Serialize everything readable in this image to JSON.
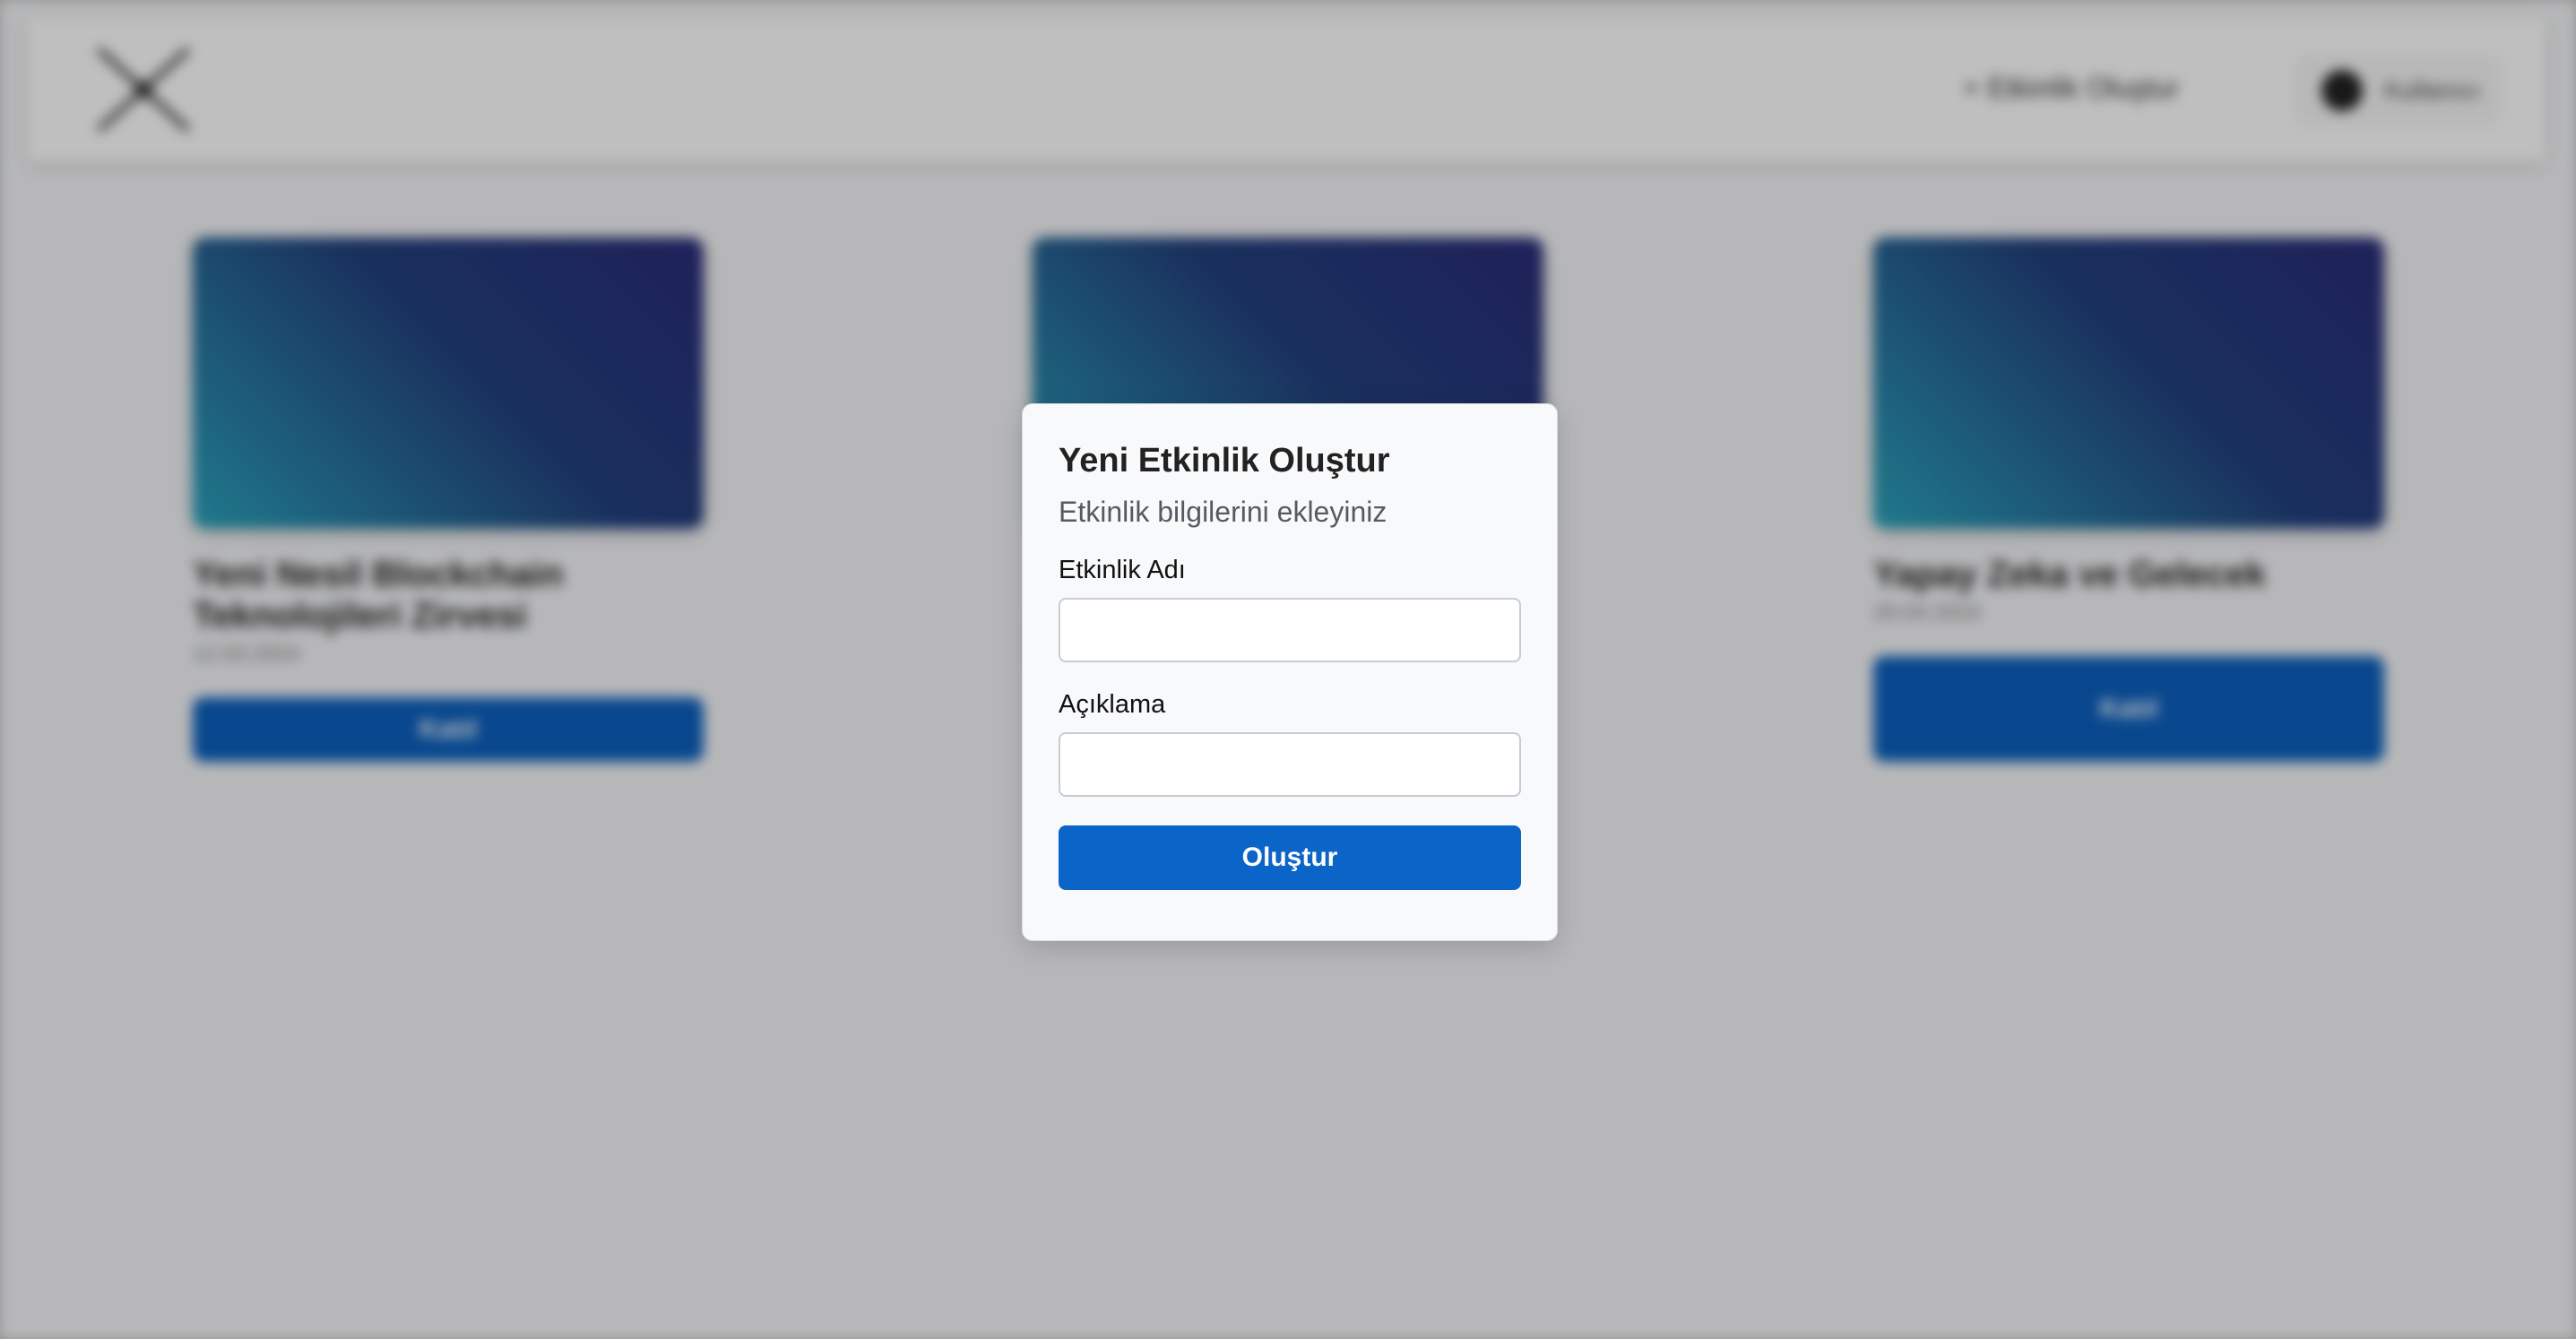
{
  "background": {
    "nav_link": "+ Etkinlik Oluştur",
    "user_name": "Kullanıcı",
    "cards": [
      {
        "title": "Yeni Nesil Blockchain Teknolojileri Zirvesi",
        "meta": "12.03.2024",
        "button": "Katıl"
      },
      {
        "title": "",
        "meta": "",
        "button": ""
      },
      {
        "title": "Yapay Zeka ve Gelecek",
        "meta": "20.04.2024",
        "button": "Katıl"
      }
    ]
  },
  "modal": {
    "title": "Yeni Etkinlik Oluştur",
    "subtitle": "Etkinlik bilgilerini ekleyiniz",
    "name_label": "Etkinlik Adı",
    "name_value": "",
    "description_label": "Açıklama",
    "description_value": "",
    "submit_label": "Oluştur"
  },
  "colors": {
    "primary_button": "#0b65c8",
    "card_gradient_start": "#2aa3bb",
    "card_gradient_end": "#2a2c78"
  },
  "icons": [
    "logo-icon",
    "user-avatar-icon"
  ]
}
